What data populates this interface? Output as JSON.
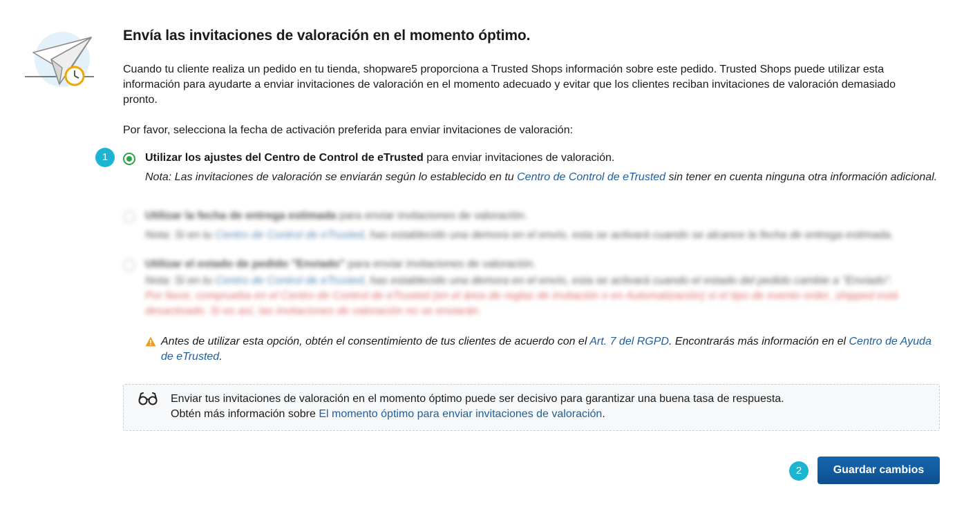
{
  "header": {
    "title": "Envía las invitaciones de valoración en el momento óptimo.",
    "intro": "Cuando tu cliente realiza un pedido en tu tienda, shopware5 proporciona a Trusted Shops información sobre este pedido. Trusted Shops puede utilizar esta información para ayudarte a enviar invitaciones de valoración en el momento adecuado y evitar que los clientes reciban invitaciones de valoración demasiado pronto.",
    "prompt": "Por favor, selecciona la fecha de activación preferida para enviar invitaciones de valoración:"
  },
  "options": [
    {
      "selected": true,
      "title_bold": "Utilizar los ajustes del Centro de Control de eTrusted",
      "title_rest": " para enviar invitaciones de valoración.",
      "note_before": "Nota: Las invitaciones de valoración se enviarán según lo establecido en tu ",
      "note_link": "Centro de Control de eTrusted",
      "note_after": " sin tener en cuenta ninguna otra información adicional."
    },
    {
      "selected": false,
      "title_bold": "Utilizar la fecha de entrega estimada",
      "title_rest": " para enviar invitaciones de valoración.",
      "note_before": "Nota: Si en tu ",
      "note_link": "Centro de Control de eTrusted",
      "note_after": ", has establecido una demora en el envío, esta se activará cuando se alcance la fecha de entrega estimada."
    },
    {
      "selected": false,
      "title_bold": "Utilizar el estado de pedido \"Enviado\"",
      "title_rest": " para enviar invitaciones de valoración.",
      "note_before": "Nota: Si en tu ",
      "note_link": "Centro de Control de eTrusted",
      "note_after": ", has establecido una demora en el envío, esta se activará cuando el estado del pedido cambie a \"Enviado\".",
      "error": "Por favor, comprueba en el Centro de Control de eTrusted (en el área de reglas de invitación o en Automatización) si el tipo de evento order_shipped está desactivado. Si es así, las invitaciones de valoración no se enviarán."
    }
  ],
  "warning": {
    "before": "Antes de utilizar esta opción, obtén el consentimiento de tus clientes de acuerdo con el ",
    "link1": "Art. 7 del RGPD",
    "middle": ". Encontrarás más información en el ",
    "link2": "Centro de Ayuda de eTrusted",
    "after": "."
  },
  "tip": {
    "line1": "Enviar tus invitaciones de valoración en el momento óptimo puede ser decisivo para garantizar una buena tasa de respuesta.",
    "line2_before": "Obtén más información sobre ",
    "line2_link": "El momento óptimo para enviar invitaciones de valoración",
    "line2_after": "."
  },
  "badges": {
    "one": "1",
    "two": "2"
  },
  "actions": {
    "save_label": "Guardar cambios"
  },
  "colors": {
    "accent": "#2fa34a",
    "link": "#1f5e9c",
    "badge": "#1bb4d1",
    "button": "#1766b0",
    "error": "#d43b3b",
    "warning": "#f29b1d"
  },
  "icons": {
    "illustration": "paper-plane-clock-icon",
    "warning": "warning-triangle-icon",
    "tip": "glasses-icon"
  }
}
